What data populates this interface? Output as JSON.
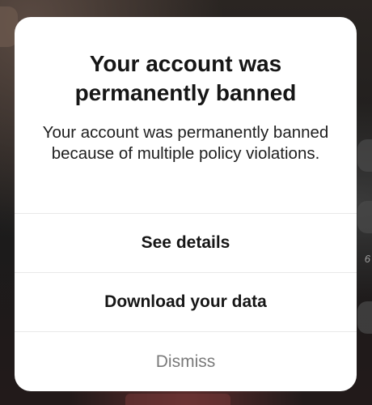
{
  "dialog": {
    "title": "Your account was permanently banned",
    "message": "Your account was permanently banned because of multiple policy violations.",
    "actions": {
      "see_details": "See details",
      "download_data": "Download your data",
      "dismiss": "Dismiss"
    }
  },
  "background": {
    "side_count": "6"
  },
  "colors": {
    "dialog_bg": "#ffffff",
    "title": "#161616",
    "dismiss_text": "#7a7a7a",
    "divider": "#e9e9e9"
  }
}
